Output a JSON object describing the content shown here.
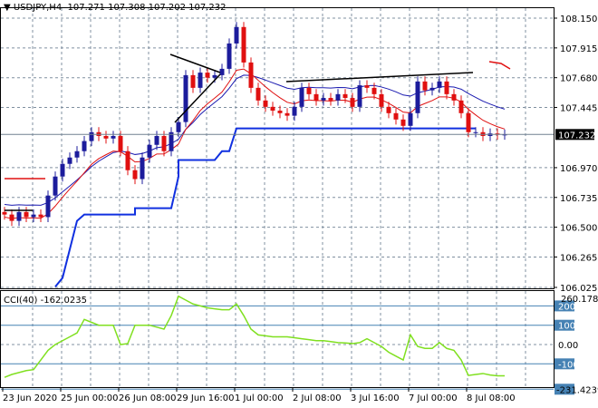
{
  "header": {
    "symbol": "USDJPY,H4",
    "ohlc": "107.271 107.308 107.202 107.232"
  },
  "price_axis": {
    "ticks": [
      "108.150",
      "107.915",
      "107.680",
      "107.445",
      "106.970",
      "106.735",
      "106.500",
      "106.265",
      "106.025"
    ],
    "current": "107.232"
  },
  "indicator": {
    "label": "CCI(40) -162.0235",
    "max": "260.1783",
    "min": "-231.4239",
    "levels": [
      "200",
      "100",
      "0.00",
      "-100"
    ]
  },
  "time_axis": [
    "23 Jun 2020",
    "25 Jun 00:00",
    "26 Jun 08:00",
    "29 Jun 16:00",
    "1 Jul 00:00",
    "2 Jul 08:00",
    "3 Jul 16:00",
    "7 Jul 00:00",
    "8 Jul 08:00"
  ],
  "colors": {
    "up": "#1c1c9c",
    "down": "#e01010",
    "ma_fast": "#e01010",
    "ma_slow": "#1a1ab0",
    "step": "#1030e0",
    "cci": "#80e020",
    "level": "#4682b4"
  },
  "chart_data": {
    "type": "candlestick",
    "open_start": 106.62,
    "closes": [
      106.6,
      106.55,
      106.62,
      106.58,
      106.6,
      106.58,
      106.75,
      106.9,
      107.0,
      107.05,
      107.1,
      107.18,
      107.25,
      107.22,
      107.2,
      107.22,
      107.1,
      106.95,
      106.88,
      107.05,
      107.15,
      107.22,
      107.1,
      107.25,
      107.33,
      107.7,
      107.6,
      107.72,
      107.68,
      107.7,
      107.75,
      107.95,
      108.08,
      107.8,
      107.6,
      107.5,
      107.45,
      107.42,
      107.4,
      107.38,
      107.45,
      107.6,
      107.55,
      107.5,
      107.52,
      107.5,
      107.55,
      107.52,
      107.45,
      107.62,
      107.6,
      107.55,
      107.45,
      107.4,
      107.35,
      107.3,
      107.4,
      107.65,
      107.58,
      107.6,
      107.65,
      107.55,
      107.5,
      107.4,
      107.25,
      107.25,
      107.22,
      107.24,
      107.23,
      107.232
    ],
    "step_line": [
      [
        7,
        106.03
      ],
      [
        8,
        106.1
      ],
      [
        10,
        106.55
      ],
      [
        11,
        106.6
      ],
      [
        18,
        106.6
      ],
      [
        18,
        106.65
      ],
      [
        23,
        106.65
      ],
      [
        24,
        106.9
      ],
      [
        24,
        107.03
      ],
      [
        29,
        107.03
      ],
      [
        30,
        107.1
      ],
      [
        31,
        107.1
      ],
      [
        32,
        107.28
      ],
      [
        65,
        107.28
      ]
    ],
    "cci": [
      -170,
      -155,
      -145,
      -135,
      -130,
      -80,
      -30,
      0,
      20,
      40,
      60,
      130,
      115,
      100,
      100,
      100,
      0,
      5,
      100,
      100,
      100,
      90,
      80,
      150,
      250,
      230,
      210,
      200,
      190,
      185,
      180,
      180,
      210,
      150,
      80,
      50,
      45,
      40,
      40,
      40,
      35,
      30,
      25,
      20,
      20,
      15,
      10,
      8,
      5,
      10,
      30,
      10,
      -10,
      -40,
      -60,
      -80,
      50,
      -10,
      -20,
      -20,
      10,
      -20,
      -30,
      -80,
      -160,
      -155,
      -150,
      -158,
      -162,
      -162
    ]
  }
}
